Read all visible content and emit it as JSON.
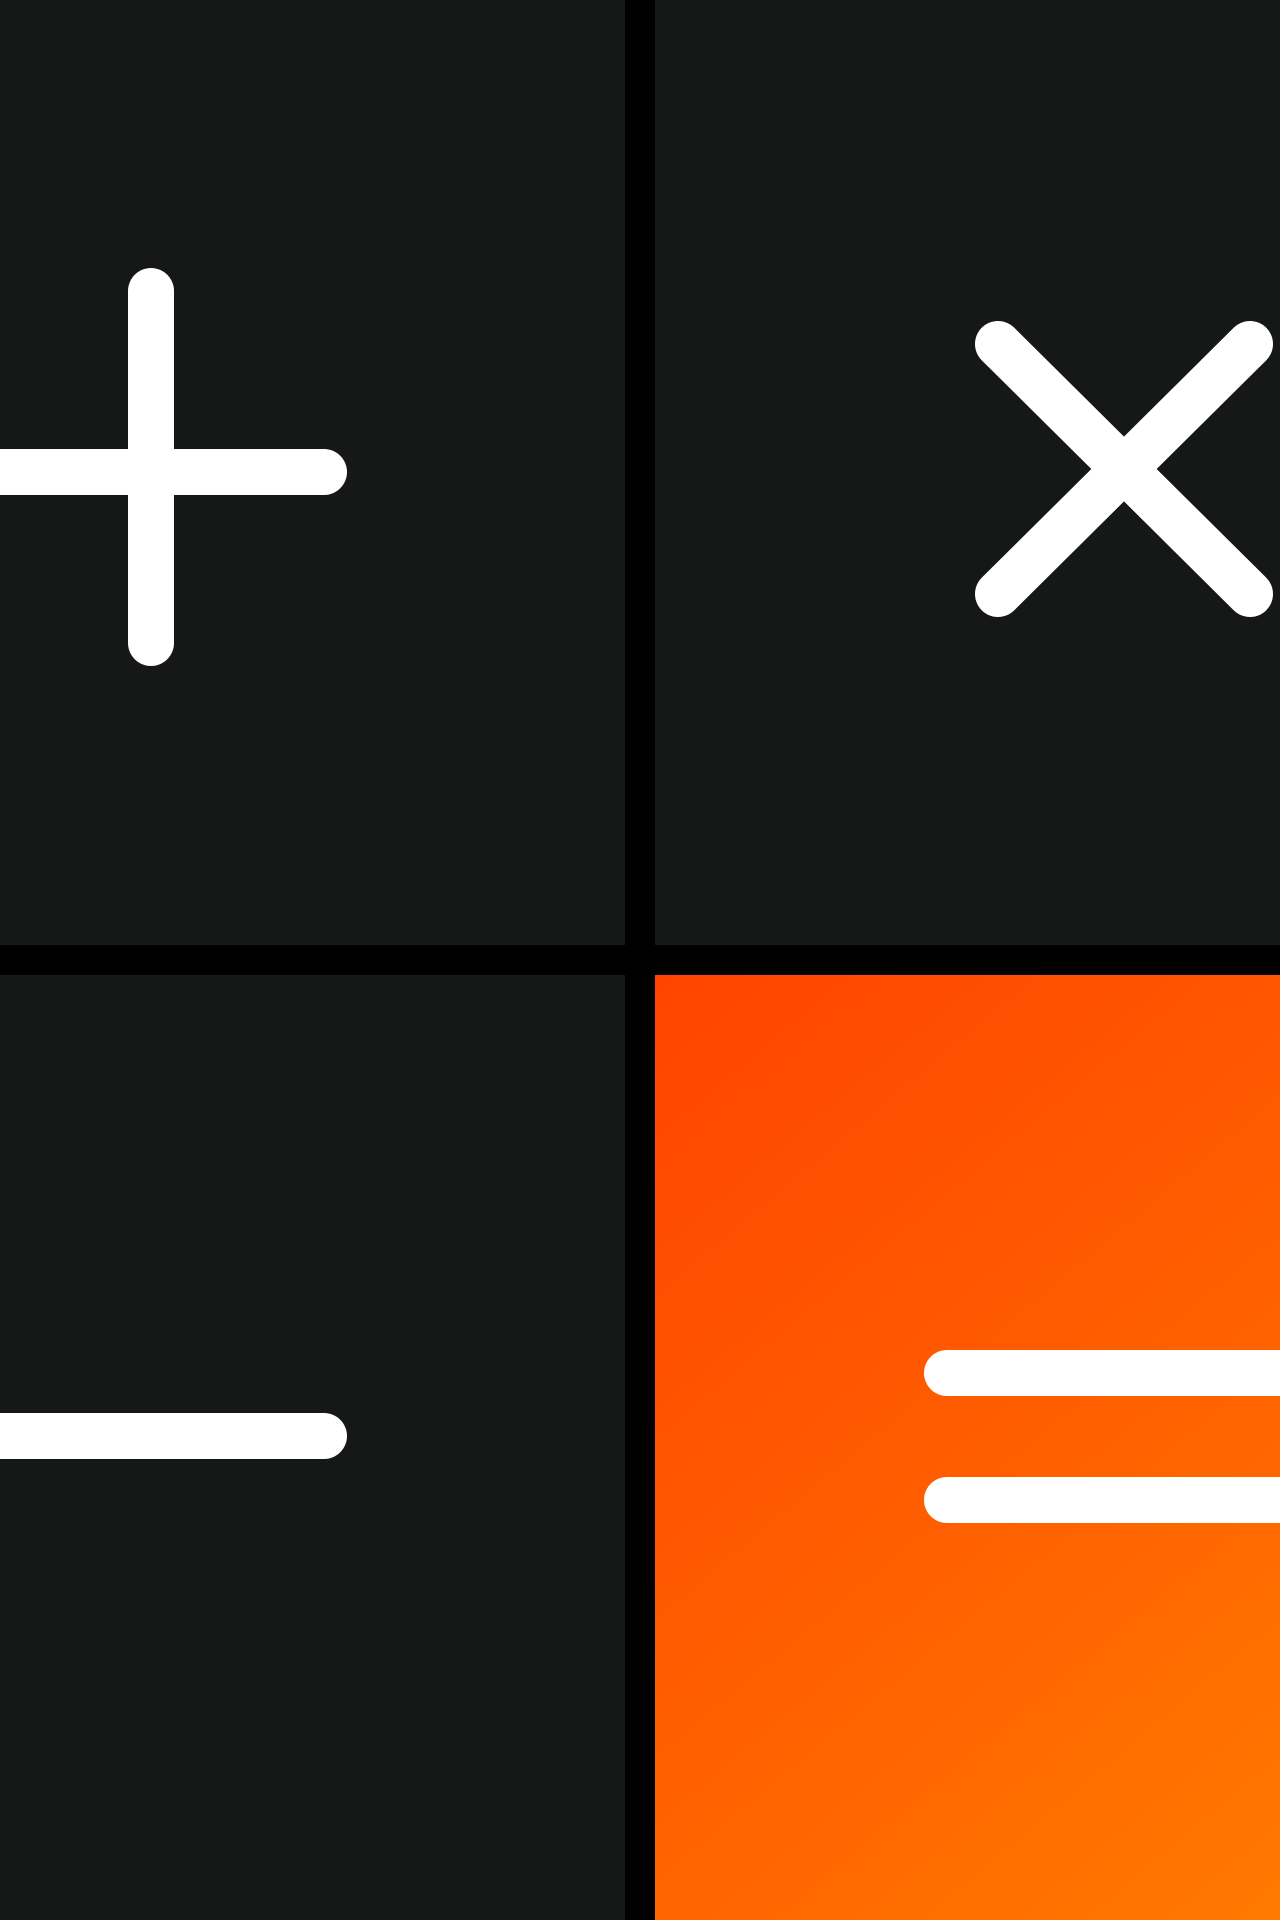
{
  "keypad": {
    "keys": [
      {
        "id": "plus",
        "label": "+",
        "icon": "plus-icon",
        "style": "dark"
      },
      {
        "id": "multiply",
        "label": "×",
        "icon": "multiply-icon",
        "style": "dark"
      },
      {
        "id": "minus",
        "label": "−",
        "icon": "minus-icon",
        "style": "dark"
      },
      {
        "id": "equals",
        "label": "=",
        "icon": "equals-icon",
        "style": "accent"
      }
    ]
  },
  "colors": {
    "background": "#000000",
    "key_dark": "#161717",
    "accent_start": "#ff4400",
    "accent_end": "#ff7900",
    "glyph": "#ffffff"
  }
}
